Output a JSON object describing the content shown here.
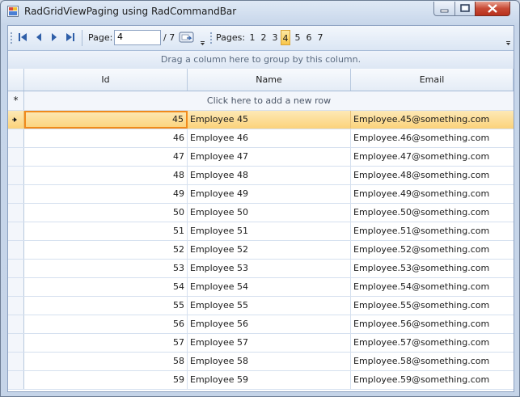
{
  "window": {
    "title": "RadGridViewPaging using RadCommandBar"
  },
  "toolbar": {
    "page_label": "Page:",
    "page_value": "4",
    "page_total": "/ 7",
    "pages_label": "Pages:",
    "pages": [
      "1",
      "2",
      "3",
      "4",
      "5",
      "6",
      "7"
    ],
    "active_page": "4"
  },
  "grid": {
    "group_panel_text": "Drag a column here to group by this column.",
    "columns": [
      "Id",
      "Name",
      "Email"
    ],
    "new_row_text": "Click here to add a new row",
    "new_row_marker": "*",
    "rows": [
      {
        "id": "45",
        "name": "Employee 45",
        "email": "Employee.45@something.com",
        "current": true
      },
      {
        "id": "46",
        "name": "Employee 46",
        "email": "Employee.46@something.com"
      },
      {
        "id": "47",
        "name": "Employee 47",
        "email": "Employee.47@something.com"
      },
      {
        "id": "48",
        "name": "Employee 48",
        "email": "Employee.48@something.com"
      },
      {
        "id": "49",
        "name": "Employee 49",
        "email": "Employee.49@something.com"
      },
      {
        "id": "50",
        "name": "Employee 50",
        "email": "Employee.50@something.com"
      },
      {
        "id": "51",
        "name": "Employee 51",
        "email": "Employee.51@something.com"
      },
      {
        "id": "52",
        "name": "Employee 52",
        "email": "Employee.52@something.com"
      },
      {
        "id": "53",
        "name": "Employee 53",
        "email": "Employee.53@something.com"
      },
      {
        "id": "54",
        "name": "Employee 54",
        "email": "Employee.54@something.com"
      },
      {
        "id": "55",
        "name": "Employee 55",
        "email": "Employee.55@something.com"
      },
      {
        "id": "56",
        "name": "Employee 56",
        "email": "Employee.56@something.com"
      },
      {
        "id": "57",
        "name": "Employee 57",
        "email": "Employee.57@something.com"
      },
      {
        "id": "58",
        "name": "Employee 58",
        "email": "Employee.58@something.com"
      },
      {
        "id": "59",
        "name": "Employee 59",
        "email": "Employee.59@something.com"
      }
    ]
  },
  "colors": {
    "current_row": "#fbd27a",
    "current_cell_border": "#f08a1c",
    "nav_arrow": "#2f5fa8"
  }
}
